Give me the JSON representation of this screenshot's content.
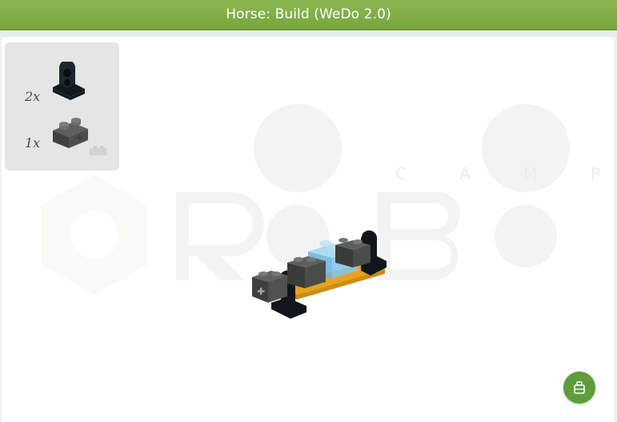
{
  "header": {
    "title": "Horse: Build (WeDo 2.0)"
  },
  "parts_list": [
    {
      "quantity": "2x",
      "part_icon": "black-beam-connector-icon"
    },
    {
      "quantity": "1x",
      "part_icon": "dark-gray-brick-icon"
    }
  ],
  "watermark": {
    "brand": "ROBO",
    "sub": "C A M P"
  },
  "colors": {
    "header": "#7dab42",
    "fab": "#5e9d3a",
    "brick_dark": "#4b4d4a",
    "part_black": "#1b1f24",
    "plate_orange": "#e8a31d",
    "brick_trans_blue": "#8fc8e8"
  },
  "actions": {
    "fab_icon": "brick-stack-icon"
  }
}
